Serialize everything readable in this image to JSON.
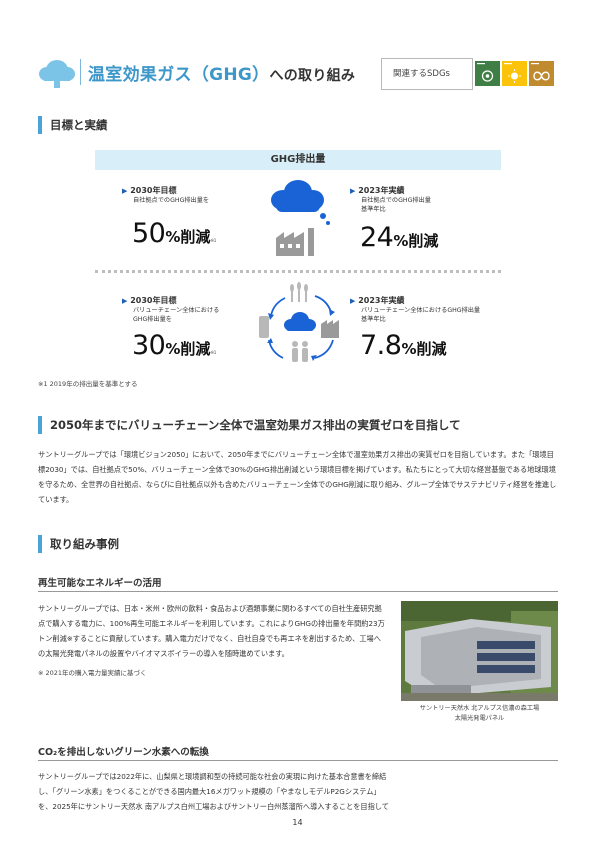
{
  "header": {
    "title_main": "温室効果ガス（GHG）",
    "title_sub": "への取り組み",
    "sdg_label": "関連するSDGs",
    "sdg_tiles": [
      {
        "icon": "sdg-13-climate-icon",
        "color": "#3f7e44"
      },
      {
        "icon": "sdg-7-energy-icon",
        "color": "#fcc30b"
      },
      {
        "icon": "sdg-12-consumption-icon",
        "color": "#bf8b2e"
      }
    ]
  },
  "sections": {
    "goals": "目標と実績",
    "zero": "2050年までにバリューチェーン全体で温室効果ガス排出の実質ゼロを目指して",
    "cases": "取り組み事例"
  },
  "ghg": {
    "head": "GHG排出量",
    "row1": {
      "left": {
        "title": "2030年目標",
        "sub1": "自社拠点でのGHG排出量を",
        "sub2": "",
        "num": "50",
        "unit": "%削減",
        "note": "※1"
      },
      "right": {
        "title": "2023年実績",
        "sub1": "自社拠点でのGHG排出量",
        "sub2": "基準年比",
        "num": "24",
        "unit": "%削減"
      }
    },
    "row2": {
      "left": {
        "title": "2030年目標",
        "sub1": "バリューチェーン全体における",
        "sub2": "GHG排出量を",
        "num": "30",
        "unit": "%削減",
        "note": "※1"
      },
      "right": {
        "title": "2023年実績",
        "sub1": "バリューチェーン全体におけるGHG排出量",
        "sub2": "基準年比",
        "num": "7.8",
        "unit": "%削減"
      }
    },
    "footnote": "※1 2019年の排出量を基準とする"
  },
  "zero_body": "サントリーグループでは「環境ビジョン2050」において、2050年までにバリューチェーン全体で温室効果ガス排出の実質ゼロを目指しています。また「環境目標2030」では、自社拠点で50%、バリューチェーン全体で30%のGHG排出削減という環境目標を掲げています。私たちにとって大切な経営基盤である地球環境を守るため、全世界の自社拠点、ならびに自社拠点以外も含めたバリューチェーン全体でのGHG削減に取り組み、グループ全体でサステナビリティ経営を推進しています。",
  "renewable": {
    "heading": "再生可能なエネルギーの活用",
    "body": "サントリーグループでは、日本・米州・欧州の飲料・食品および酒類事業に関わるすべての自社生産研究拠点で購入する電力に、100%再生可能エネルギーを利用しています。これによりGHGの排出量を年間約23万トン削減※することに貢献しています。購入電力だけでなく、自社自身でも再エネを創出するため、工場への太陽光発電パネルの設置やバイオマスボイラーの導入を随時進めています。",
    "note": "※ 2021年の購入電力量実績に基づく",
    "caption1": "サントリー天然水 北アルプス信濃の森工場",
    "caption2": "太陽光発電パネル"
  },
  "hydrogen": {
    "heading": "CO₂を排出しないグリーン水素への転換",
    "body": "サントリーグループでは2022年に、山梨県と環境調和型の持続可能な社会の実現に向けた基本合意書を締結し、「グリーン水素」をつくることができる国内最大16メガワット規模の「やまなしモデルP2Gシステム」を、2025年にサントリー天然水 南アルプス白州工場およびサントリー白州蒸溜所へ導入することを目指して"
  },
  "page_number": "14"
}
